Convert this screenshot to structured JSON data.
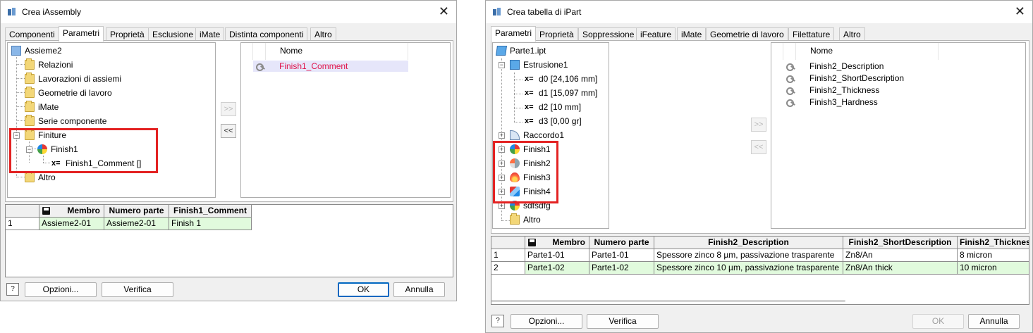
{
  "assembly_dialog": {
    "title": "Crea iAssembly",
    "tabs": [
      "Componenti",
      "Parametri",
      "Proprietà",
      "Esclusione",
      "iMate",
      "Distinta componenti",
      "Altro"
    ],
    "tree": {
      "root": "Assieme2",
      "items": [
        "Relazioni",
        "Lavorazioni di assiemi",
        "Geometrie di lavoro",
        "iMate",
        "Serie componente",
        "Finiture"
      ],
      "finish": "Finish1",
      "param_prefix": "x=",
      "param": "Finish1_Comment []",
      "last": "Altro"
    },
    "list_header": "Nome",
    "list_items": [
      "Finish1_Comment"
    ],
    "add_button": ">>",
    "remove_button": "<<",
    "grid": {
      "headers": [
        "Membro",
        "Numero parte",
        "Finish1_Comment"
      ],
      "rows": [
        {
          "num": "1",
          "cells": [
            "Assieme2-01",
            "Assieme2-01",
            "Finish 1"
          ]
        }
      ]
    },
    "help": "?",
    "options_button": "Opzioni...",
    "verify_button": "Verifica",
    "ok_button": "OK",
    "cancel_button": "Annulla"
  },
  "part_dialog": {
    "title": "Crea tabella di iPart",
    "tabs": [
      "Parametri",
      "Proprietà",
      "Soppressione",
      "iFeature",
      "iMate",
      "Geometrie di lavoro",
      "Filettature",
      "Altro"
    ],
    "tree": {
      "root": "Parte1.ipt",
      "extrusion": "Estrusione1",
      "param_prefix": "x=",
      "params": [
        "d0 [24,106 mm]",
        "d1 [15,097 mm]",
        "d2 [10 mm]",
        "d3 [0,00 gr]"
      ],
      "fillet": "Raccordo1",
      "finishes": [
        "Finish1",
        "Finish2",
        "Finish3",
        "Finish4"
      ],
      "extra": "sdfsdfg",
      "last": "Altro"
    },
    "list_header": "Nome",
    "list_items": [
      "Finish2_Description",
      "Finish2_ShortDescription",
      "Finish2_Thickness",
      "Finish3_Hardness"
    ],
    "add_button": ">>",
    "remove_button": "<<",
    "grid": {
      "headers": [
        "Membro",
        "Numero parte",
        "Finish2_Description",
        "Finish2_ShortDescription",
        "Finish2_Thicknes"
      ],
      "rows": [
        {
          "num": "1",
          "cells": [
            "Parte1-01",
            "Parte1-01",
            "Spessore zinco 8 µm, passivazione trasparente",
            "Zn8/An",
            "8 micron"
          ]
        },
        {
          "num": "2",
          "cells": [
            "Parte1-02",
            "Parte1-02",
            "Spessore zinco 10 µm, passivazione trasparente",
            "Zn8/An thick",
            "10 micron"
          ]
        }
      ]
    },
    "help": "?",
    "options_button": "Opzioni...",
    "verify_button": "Verifica",
    "ok_button": "OK",
    "cancel_button": "Annulla"
  },
  "colors": {
    "highlight": "#e32222",
    "selection": "#e6e6fa",
    "selected_text": "#e0144c",
    "grid_green": "#e1fadd",
    "default_button": "#0067c0"
  }
}
